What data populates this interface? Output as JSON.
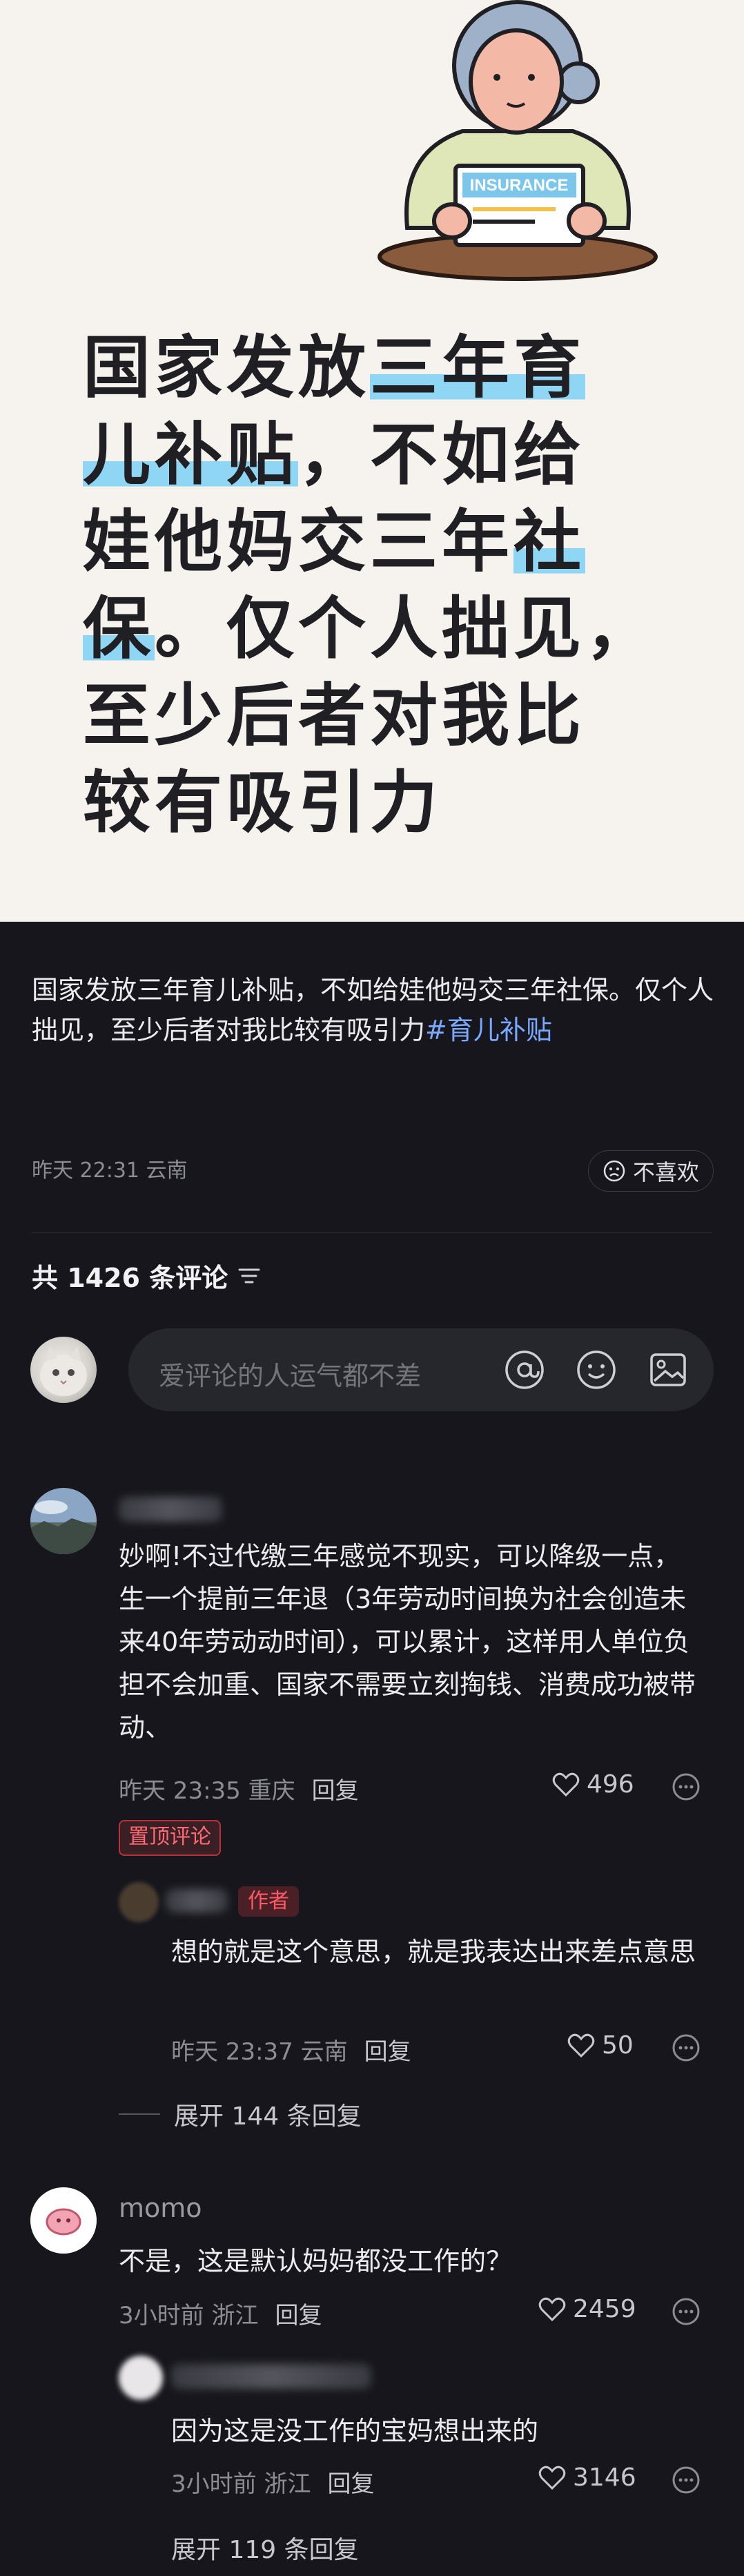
{
  "hero": {
    "badge_text": "INSURANCE",
    "title_lines": [
      {
        "plain": "国家发放",
        "hl": "三年育"
      },
      {
        "hl": "儿补贴",
        "plain": "，不如给"
      },
      {
        "plain": "娃他妈交三年",
        "hl": "社"
      },
      {
        "hl": "保",
        "plain": "。仅个人拙见，"
      },
      {
        "plain": "至少后者对我比"
      },
      {
        "plain": "较有吸引力"
      }
    ]
  },
  "post": {
    "text": "国家发放三年育儿补贴，不如给娃他妈交三年社保。仅个人拙见，至少后者对我比较有吸引力",
    "hashtag": "#育儿补贴",
    "meta": "昨天 22:31 云南",
    "dislike_label": "不喜欢"
  },
  "comments_header": {
    "label": "共 1426 条评论"
  },
  "comment_input": {
    "placeholder": "爱评论的人运气都不差"
  },
  "comments": [
    {
      "text": "妙啊!不过代缴三年感觉不现实，可以降级一点，生一个提前三年退（3年劳动时间换为社会创造未来40年劳动动时间），可以累计，这样用人单位负担不会加重、国家不需要立刻掏钱、消费成功被带动、",
      "meta": "昨天 23:35 重庆",
      "reply_label": "回复",
      "likes": "496",
      "pin_label": "置顶评论",
      "reply": {
        "author_badge": "作者",
        "text": "想的就是这个意思，就是我表达出来差点意思",
        "meta": "昨天 23:37 云南",
        "reply_label": "回复",
        "likes": "50"
      },
      "expand_label": "展开 144 条回复"
    },
    {
      "username": "momo",
      "text": "不是，这是默认妈妈都没工作的？",
      "meta": "3小时前 浙江",
      "reply_label": "回复",
      "likes": "2459",
      "reply": {
        "text": "因为这是没工作的宝妈想出来的",
        "meta": "3小时前 浙江",
        "reply_label": "回复",
        "likes": "3146"
      },
      "expand_label": "展开 119 条回复"
    }
  ],
  "colors": {
    "background": "#16161c",
    "highlight": "#8fd6f5",
    "hashtag": "#7aa9ff",
    "pin_red": "#ff6a74"
  }
}
